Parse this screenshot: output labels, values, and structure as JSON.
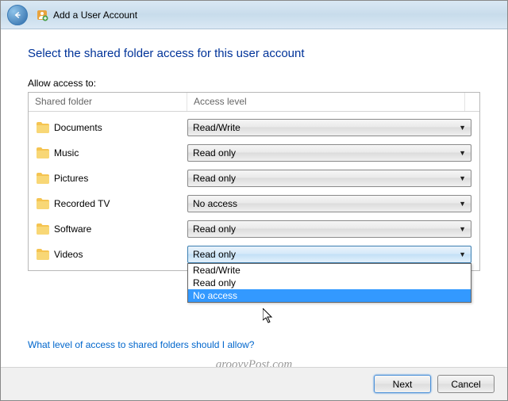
{
  "titlebar": {
    "title": "Add a User Account"
  },
  "heading": "Select the shared folder access for this user account",
  "allow_label": "Allow access to:",
  "columns": {
    "folder": "Shared folder",
    "access": "Access level"
  },
  "rows": [
    {
      "name": "Documents",
      "access": "Read/Write",
      "open": false
    },
    {
      "name": "Music",
      "access": "Read only",
      "open": false
    },
    {
      "name": "Pictures",
      "access": "Read only",
      "open": false
    },
    {
      "name": "Recorded TV",
      "access": "No access",
      "open": false
    },
    {
      "name": "Software",
      "access": "Read only",
      "open": false
    },
    {
      "name": "Videos",
      "access": "Read only",
      "open": true
    }
  ],
  "dropdown_options": [
    "Read/Write",
    "Read only",
    "No access"
  ],
  "dropdown_highlight_index": 2,
  "help_link": "What level of access to shared folders should I allow?",
  "buttons": {
    "next": "Next",
    "cancel": "Cancel"
  },
  "watermark": "groovyPost.com"
}
